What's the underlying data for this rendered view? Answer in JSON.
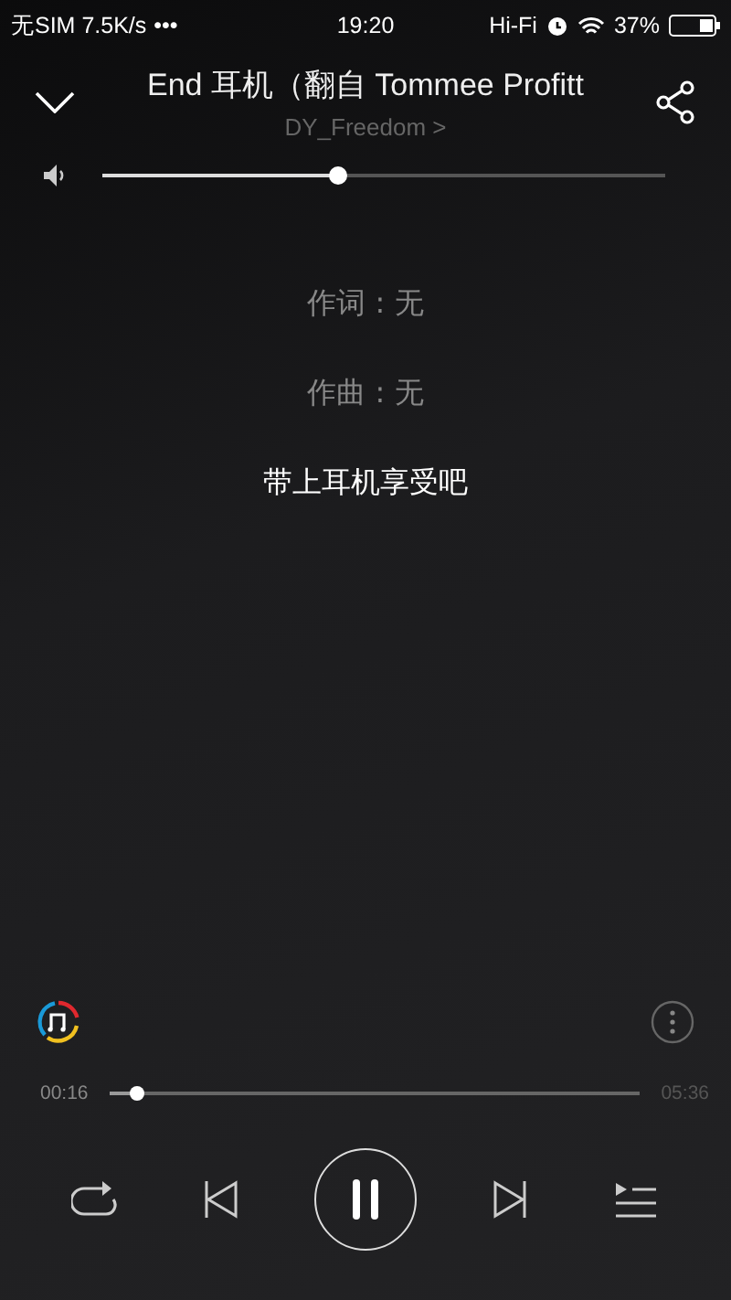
{
  "status_bar": {
    "carrier": "无SIM 7.5K/s",
    "dots": "•••",
    "time": "19:20",
    "hifi": "Hi-Fi",
    "battery": "37%"
  },
  "header": {
    "title": "End 耳机（翻自 Tommee Profitt",
    "artist": "DY_Freedom",
    "artist_chevron": ">"
  },
  "lyrics": [
    {
      "text": "作词 : 无",
      "kind": "credit"
    },
    {
      "text": "作曲 : 无",
      "kind": "credit"
    },
    {
      "text": "带上耳机享受吧",
      "kind": "line"
    }
  ],
  "progress": {
    "elapsed": "00:16",
    "total": "05:36"
  },
  "controls": {
    "playing": true
  }
}
